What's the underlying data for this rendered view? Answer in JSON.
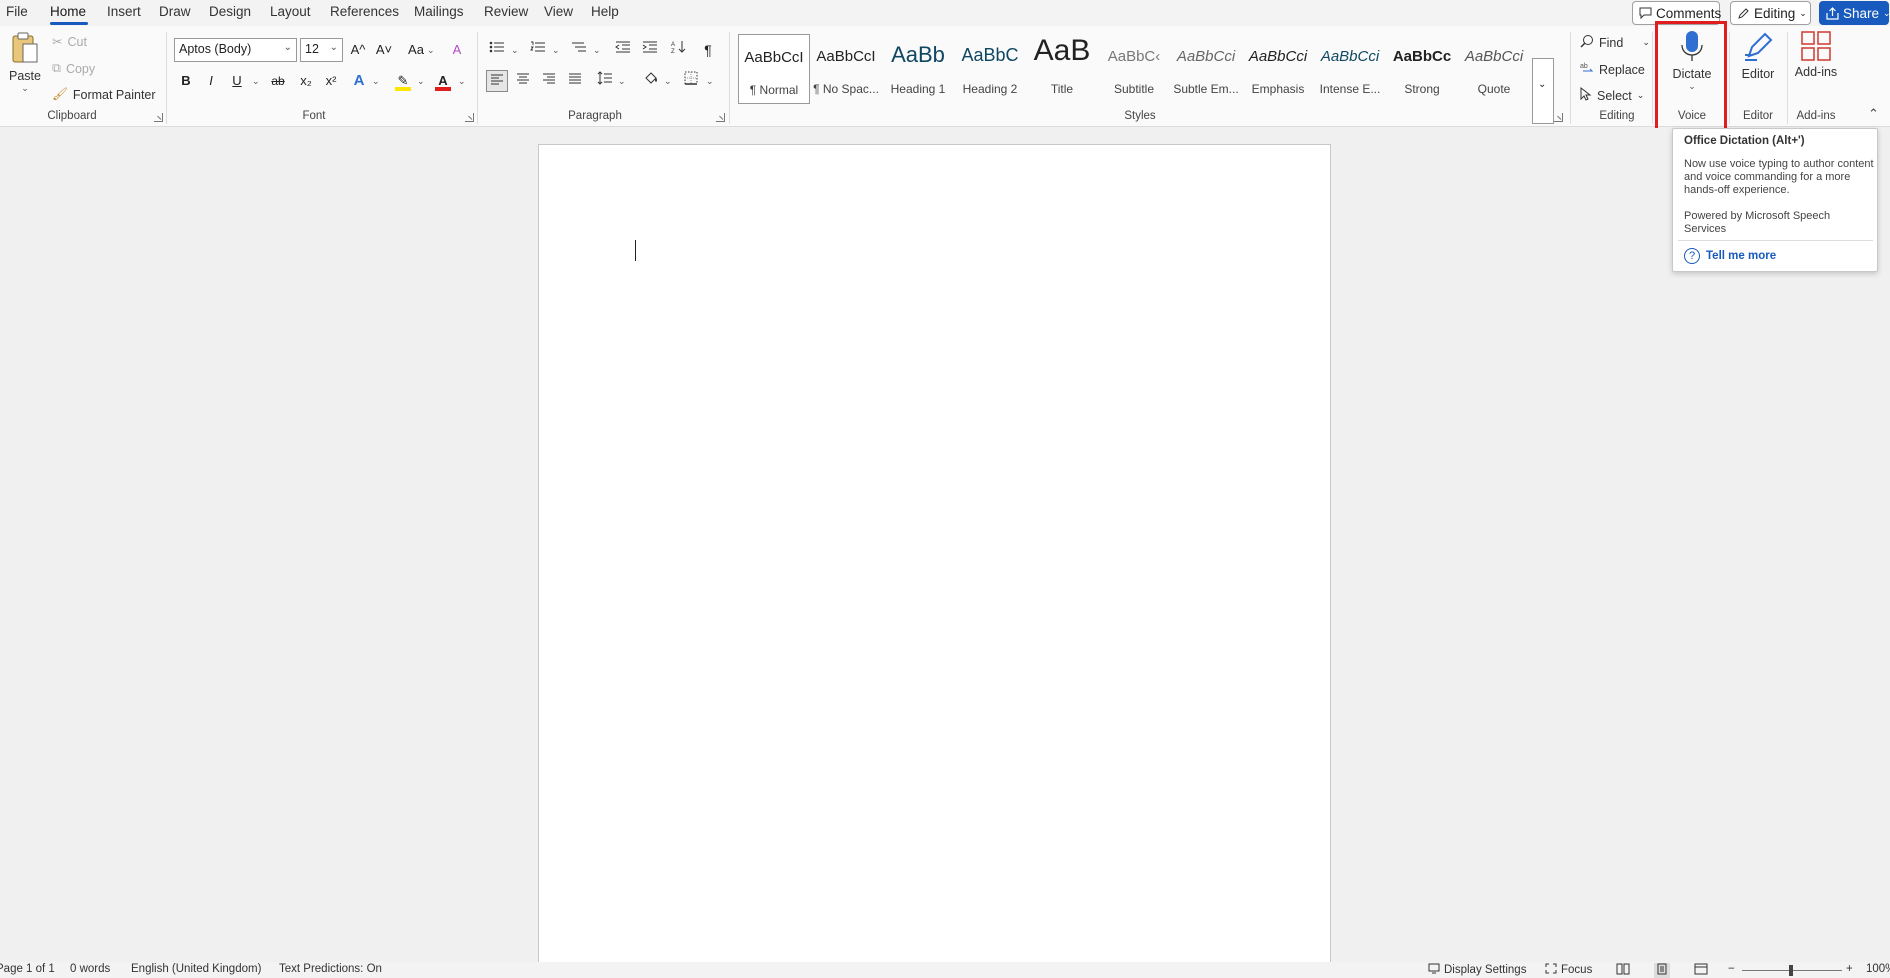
{
  "menubar": {
    "tabs": [
      "File",
      "Home",
      "Insert",
      "Draw",
      "Design",
      "Layout",
      "References",
      "Mailings",
      "Review",
      "View",
      "Help"
    ],
    "active_tab": "Home",
    "comments_label": "Comments",
    "editing_label": "Editing",
    "share_label": "Share"
  },
  "clipboard": {
    "paste_label": "Paste",
    "cut_label": "Cut",
    "copy_label": "Copy",
    "format_painter_label": "Format Painter",
    "group_label": "Clipboard"
  },
  "font": {
    "font_name": "Aptos (Body)",
    "font_size": "12",
    "grow_label": "A^",
    "shrink_label": "A˅",
    "change_case_label": "Aa",
    "bold": "B",
    "italic": "I",
    "underline": "U",
    "strike": "ab",
    "subscript": "x₂",
    "superscript": "x²",
    "text_effects": "A",
    "font_color": "A",
    "group_label": "Font"
  },
  "paragraph": {
    "group_label": "Paragraph",
    "pilcrow": "¶"
  },
  "styles": {
    "group_label": "Styles",
    "items": [
      {
        "sample": "AaBbCcI",
        "name": "¶ Normal"
      },
      {
        "sample": "AaBbCcI",
        "name": "¶ No Spac..."
      },
      {
        "sample": "AaBb",
        "name": "Heading 1"
      },
      {
        "sample": "AaBbC",
        "name": "Heading 2"
      },
      {
        "sample": "AaB",
        "name": "Title"
      },
      {
        "sample": "AaBbC‹",
        "name": "Subtitle"
      },
      {
        "sample": "AaBbCci",
        "name": "Subtle Em..."
      },
      {
        "sample": "AaBbCci",
        "name": "Emphasis"
      },
      {
        "sample": "AaBbCci",
        "name": "Intense E..."
      },
      {
        "sample": "AaBbCc",
        "name": "Strong"
      },
      {
        "sample": "AaBbCci",
        "name": "Quote"
      }
    ]
  },
  "editing": {
    "find_label": "Find",
    "replace_label": "Replace",
    "select_label": "Select",
    "group_label": "Editing"
  },
  "voice": {
    "dictate_label": "Dictate",
    "group_label": "Voice"
  },
  "editor": {
    "label": "Editor",
    "group_label": "Editor"
  },
  "addins": {
    "label": "Add-ins",
    "group_label": "Add-ins"
  },
  "tooltip": {
    "title": "Office Dictation (Alt+')",
    "body": "Now use voice typing to author content and voice commanding for a more hands-off experience.",
    "body2": "Powered by Microsoft Speech Services",
    "link": "Tell me more"
  },
  "statusbar": {
    "page": "Page 1 of 1",
    "words": "0 words",
    "language": "English (United Kingdom)",
    "predictions": "Text Predictions: On",
    "display_settings": "Display Settings",
    "focus": "Focus",
    "zoom_minus": "−",
    "zoom_plus": "+",
    "zoom": "100%"
  },
  "colors": {
    "accent": "#185abd",
    "highlight_box": "#e01e1e",
    "font_color_bar": "#e01e1e",
    "highlight_color_bar": "#ffe600"
  }
}
